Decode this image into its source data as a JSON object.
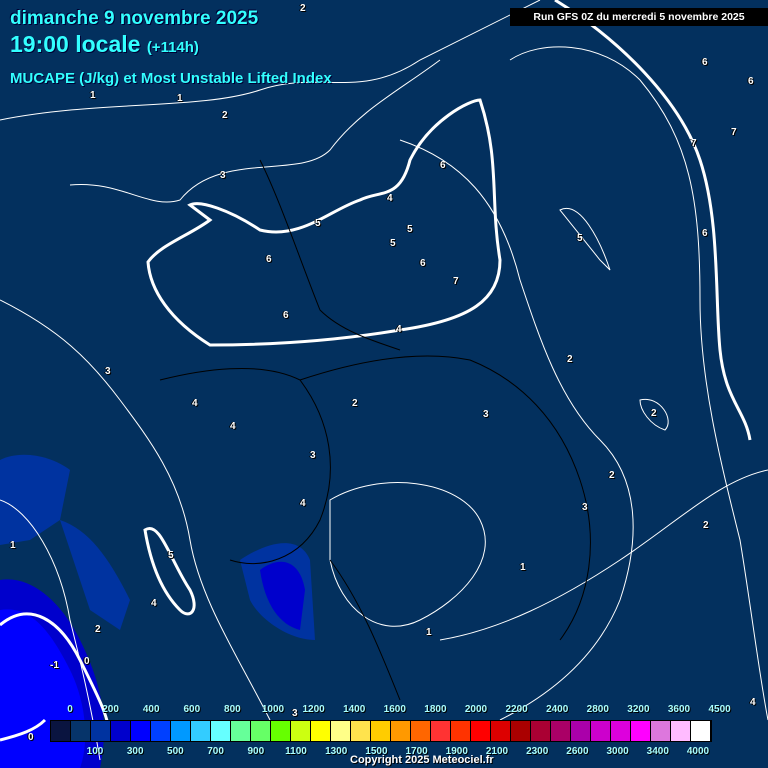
{
  "header": {
    "date": "dimanche 9 novembre 2025",
    "time": "19:00 locale",
    "lead": "(+114h)",
    "parameter": "MUCAPE (J/kg) et Most Unstable Lifted Index",
    "run": "Run GFS 0Z du mercredi 5 novembre 2025"
  },
  "map_labels": [
    "2",
    "1",
    "1",
    "2",
    "3",
    "6",
    "4",
    "5",
    "5",
    "5",
    "6",
    "6",
    "7",
    "6",
    "4",
    "6",
    "6",
    "7",
    "7",
    "6",
    "5",
    "2",
    "2",
    "3",
    "4",
    "4",
    "2",
    "3",
    "3",
    "2",
    "3",
    "4",
    "2",
    "1",
    "5",
    "4",
    "2",
    "1",
    "1",
    "0",
    "-1",
    "0",
    "3",
    "4"
  ],
  "legend": {
    "unit": "J/kg",
    "top_labels": [
      "0",
      "200",
      "400",
      "600",
      "800",
      "1000",
      "1200",
      "1400",
      "1600",
      "1800",
      "2000",
      "2200",
      "2400",
      "2800",
      "3200",
      "3600",
      "4500"
    ],
    "bottom_labels": [
      "100",
      "300",
      "500",
      "700",
      "900",
      "1100",
      "1300",
      "1500",
      "1700",
      "1900",
      "2100",
      "2300",
      "2600",
      "3000",
      "3400",
      "4000"
    ],
    "colors": [
      "#0a1440",
      "#06346a",
      "#0033a0",
      "#0000cc",
      "#0000ff",
      "#0040ff",
      "#0099ff",
      "#33ccff",
      "#66ffff",
      "#66ff99",
      "#66ff66",
      "#66ff00",
      "#ccff11",
      "#ffff00",
      "#ffff88",
      "#ffe34d",
      "#ffcc00",
      "#ff9900",
      "#ff6600",
      "#ff3333",
      "#ff3300",
      "#ff0000",
      "#dd0000",
      "#aa0000",
      "#aa0033",
      "#aa0066",
      "#aa00aa",
      "#cc00cc",
      "#dd00dd",
      "#ff00ff",
      "#dd77dd",
      "#ffbbff",
      "#ffffff"
    ]
  },
  "copyright": "Copyright 2025 Meteociel.fr"
}
